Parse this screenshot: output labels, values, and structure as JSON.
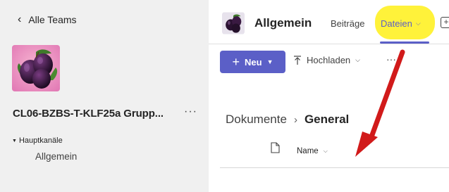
{
  "sidebar": {
    "back_label": "Alle Teams",
    "team_name": "CL06-BZBS-T-KLF25a Grupp...",
    "more_label": "···",
    "section_label": "Hauptkanäle",
    "channels": [
      {
        "label": "Allgemein"
      }
    ]
  },
  "header": {
    "channel_title": "Allgemein",
    "tabs": [
      {
        "label": "Beiträge"
      },
      {
        "label": "Dateien"
      }
    ],
    "add_tab_symbol": "+"
  },
  "toolbar": {
    "new_label": "Neu",
    "upload_label": "Hochladen",
    "more_label": "···"
  },
  "breadcrumb": {
    "root": "Dokumente",
    "current": "General"
  },
  "file_list": {
    "columns": [
      {
        "label": "Name"
      }
    ]
  },
  "colors": {
    "accent": "#5b5fc7",
    "highlight": "#fff23a",
    "annotation_arrow": "#d11a1a",
    "sidebar_bg": "#f0f0f0"
  },
  "icons": {
    "team_avatar": "plum-fruit-image",
    "channel_avatar": "plum-fruit-image",
    "file_type": "document-icon"
  }
}
